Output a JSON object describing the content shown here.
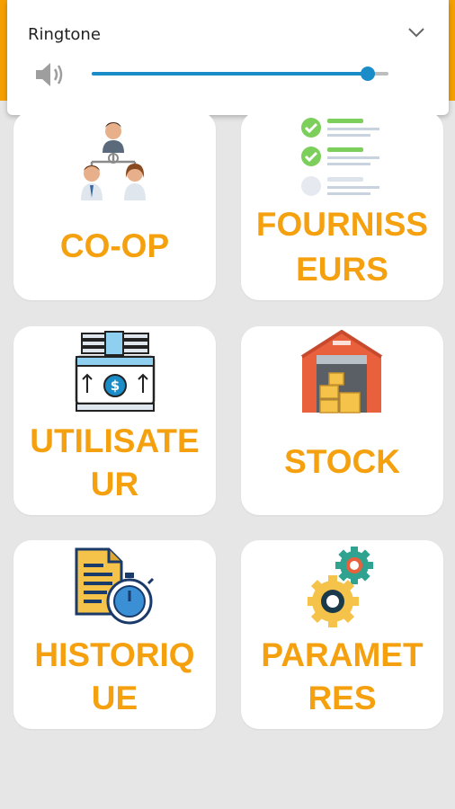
{
  "volume_panel": {
    "title": "Ringtone",
    "level": 0.93,
    "icons": [
      "speaker-icon",
      "chevron-down-icon"
    ]
  },
  "tiles": [
    {
      "line1": "CO-OP",
      "line2": "",
      "icon": "team-hierarchy-icon"
    },
    {
      "line1": "FOURNISS",
      "line2": "EURS",
      "icon": "checklist-icon"
    },
    {
      "line1": "UTILISATE",
      "line2": "UR",
      "icon": "cash-register-icon"
    },
    {
      "line1": "STOCK",
      "line2": "",
      "icon": "warehouse-icon"
    },
    {
      "line1": "HISTORIQ",
      "line2": "UE",
      "icon": "document-stopwatch-icon"
    },
    {
      "line1": "PARAMET",
      "line2": "RES",
      "icon": "gears-icon"
    }
  ],
  "colors": {
    "accent": "#f5a000",
    "label": "#f5a10f",
    "slider": "#1a8cc8",
    "background": "#e6e6e6"
  }
}
